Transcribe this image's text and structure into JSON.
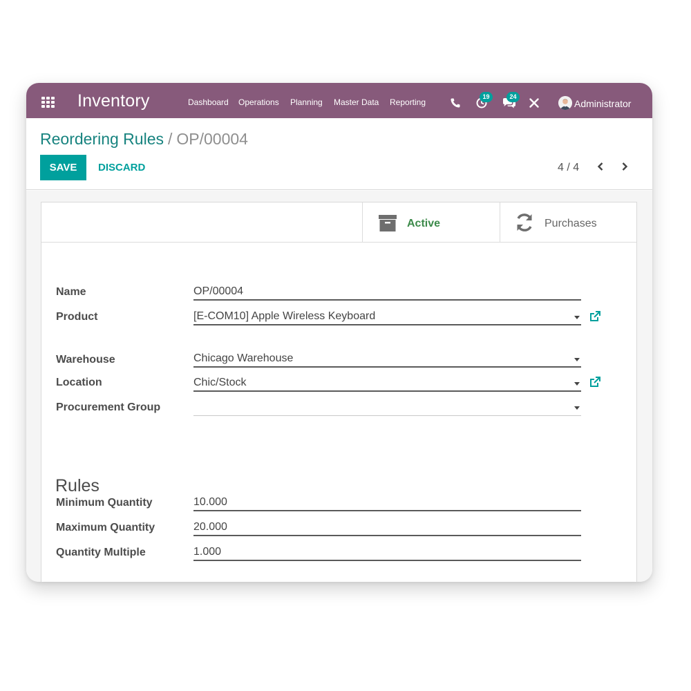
{
  "navbar": {
    "app_title": "Inventory",
    "menu": [
      "Dashboard",
      "Operations",
      "Planning",
      "Master Data",
      "Reporting"
    ],
    "activity_count": "19",
    "messages_count": "24",
    "user_name": "Administrator",
    "icons": [
      "apps-grid-icon",
      "phone-icon",
      "activity-icon",
      "chat-icon",
      "debug-icon",
      "avatar"
    ]
  },
  "control": {
    "breadcrumb_parent": "Reordering Rules",
    "breadcrumb_separator": "/",
    "breadcrumb_current": "OP/00004",
    "save_label": "SAVE",
    "discard_label": "DISCARD",
    "pager": "4 / 4"
  },
  "smart_buttons": {
    "active_label": "Active",
    "purchases_label": "Purchases"
  },
  "form": {
    "name_label": "Name",
    "name_value": "OP/00004",
    "product_label": "Product",
    "product_value": "[E-COM10] Apple Wireless Keyboard",
    "warehouse_label": "Warehouse",
    "warehouse_value": "Chicago Warehouse",
    "location_label": "Location",
    "location_value": "Chic/Stock",
    "procurement_group_label": "Procurement Group",
    "procurement_group_value": "",
    "rules_title": "Rules",
    "min_qty_label": "Minimum Quantity",
    "min_qty_value": "10.000",
    "max_qty_label": "Maximum Quantity",
    "max_qty_value": "20.000",
    "qty_multiple_label": "Quantity Multiple",
    "qty_multiple_value": "1.000"
  },
  "colors": {
    "navbar": "#875a7b",
    "primary": "#00a09d",
    "link": "#17837f",
    "active_green": "#3c8a4a"
  }
}
